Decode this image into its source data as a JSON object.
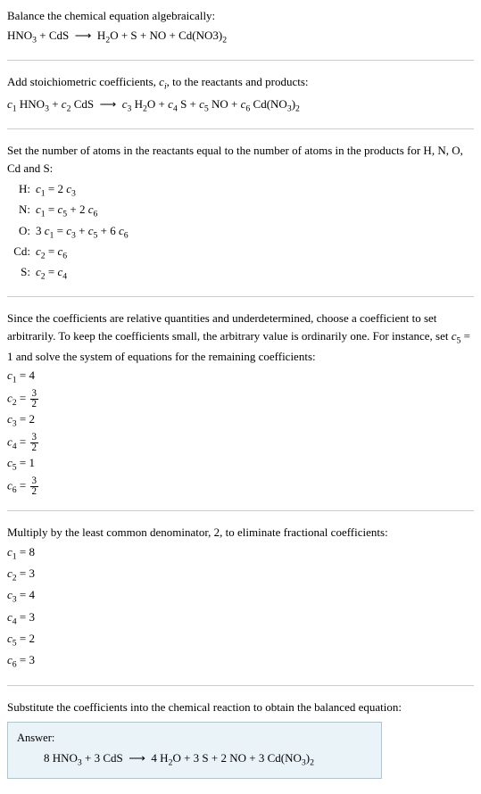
{
  "section1": {
    "line1a": "Balance the chemical equation algebraically:",
    "line1b_html": "HNO<sub>3</sub> + CdS &nbsp;⟶&nbsp; H<sub>2</sub>O + S + NO + Cd(NO3)<sub>2</sub>"
  },
  "section2": {
    "line1_html": "Add stoichiometric coefficients, <span class=\"italic-c\">c</span><span class=\"sub-italic\">i</span>, to the reactants and products:",
    "line2_html": "<span class=\"italic-c\">c</span><sub>1</sub> HNO<sub>3</sub> + <span class=\"italic-c\">c</span><sub>2</sub> CdS &nbsp;⟶&nbsp; <span class=\"italic-c\">c</span><sub>3</sub> H<sub>2</sub>O + <span class=\"italic-c\">c</span><sub>4</sub> S + <span class=\"italic-c\">c</span><sub>5</sub> NO + <span class=\"italic-c\">c</span><sub>6</sub> Cd(NO<sub>3</sub>)<sub>2</sub>"
  },
  "section3": {
    "intro": "Set the number of atoms in the reactants equal to the number of atoms in the products for H, N, O, Cd and S:",
    "rows": [
      {
        "label": "H:",
        "eq_html": "<span class=\"italic-c\">c</span><sub>1</sub> = 2 <span class=\"italic-c\">c</span><sub>3</sub>"
      },
      {
        "label": "N:",
        "eq_html": "<span class=\"italic-c\">c</span><sub>1</sub> = <span class=\"italic-c\">c</span><sub>5</sub> + 2 <span class=\"italic-c\">c</span><sub>6</sub>"
      },
      {
        "label": "O:",
        "eq_html": "3 <span class=\"italic-c\">c</span><sub>1</sub> = <span class=\"italic-c\">c</span><sub>3</sub> + <span class=\"italic-c\">c</span><sub>5</sub> + 6 <span class=\"italic-c\">c</span><sub>6</sub>"
      },
      {
        "label": "Cd:",
        "eq_html": "<span class=\"italic-c\">c</span><sub>2</sub> = <span class=\"italic-c\">c</span><sub>6</sub>"
      },
      {
        "label": "S:",
        "eq_html": "<span class=\"italic-c\">c</span><sub>2</sub> = <span class=\"italic-c\">c</span><sub>4</sub>"
      }
    ]
  },
  "section4": {
    "intro_html": "Since the coefficients are relative quantities and underdetermined, choose a coefficient to set arbitrarily. To keep the coefficients small, the arbitrary value is ordinarily one. For instance, set <span class=\"italic-c\">c</span><sub>5</sub> = 1 and solve the system of equations for the remaining coefficients:",
    "coeffs_html": [
      "<span class=\"italic-c\">c</span><sub>1</sub> = 4",
      "<span class=\"italic-c\">c</span><sub>2</sub> = <span class=\"frac\"><span class=\"num\">3</span><span class=\"den\">2</span></span>",
      "<span class=\"italic-c\">c</span><sub>3</sub> = 2",
      "<span class=\"italic-c\">c</span><sub>4</sub> = <span class=\"frac\"><span class=\"num\">3</span><span class=\"den\">2</span></span>",
      "<span class=\"italic-c\">c</span><sub>5</sub> = 1",
      "<span class=\"italic-c\">c</span><sub>6</sub> = <span class=\"frac\"><span class=\"num\">3</span><span class=\"den\">2</span></span>"
    ]
  },
  "section5": {
    "intro": "Multiply by the least common denominator, 2, to eliminate fractional coefficients:",
    "coeffs_html": [
      "<span class=\"italic-c\">c</span><sub>1</sub> = 8",
      "<span class=\"italic-c\">c</span><sub>2</sub> = 3",
      "<span class=\"italic-c\">c</span><sub>3</sub> = 4",
      "<span class=\"italic-c\">c</span><sub>4</sub> = 3",
      "<span class=\"italic-c\">c</span><sub>5</sub> = 2",
      "<span class=\"italic-c\">c</span><sub>6</sub> = 3"
    ]
  },
  "section6": {
    "intro": "Substitute the coefficients into the chemical reaction to obtain the balanced equation:",
    "answer_label": "Answer:",
    "answer_eq_html": "8 HNO<sub>3</sub> + 3 CdS &nbsp;⟶&nbsp; 4 H<sub>2</sub>O + 3 S + 2 NO + 3 Cd(NO<sub>3</sub>)<sub>2</sub>"
  },
  "chart_data": {
    "type": "table",
    "title": "Balanced chemical equation system",
    "reactants": [
      "HNO3",
      "CdS"
    ],
    "products": [
      "H2O",
      "S",
      "NO",
      "Cd(NO3)2"
    ],
    "atom_balance": {
      "H": "c1 = 2 c3",
      "N": "c1 = c5 + 2 c6",
      "O": "3 c1 = c3 + c5 + 6 c6",
      "Cd": "c2 = c6",
      "S": "c2 = c4"
    },
    "fractional_solution": {
      "c1": 4,
      "c2": 1.5,
      "c3": 2,
      "c4": 1.5,
      "c5": 1,
      "c6": 1.5
    },
    "integer_solution": {
      "c1": 8,
      "c2": 3,
      "c3": 4,
      "c4": 3,
      "c5": 2,
      "c6": 3
    },
    "balanced_equation": "8 HNO3 + 3 CdS -> 4 H2O + 3 S + 2 NO + 3 Cd(NO3)2"
  }
}
